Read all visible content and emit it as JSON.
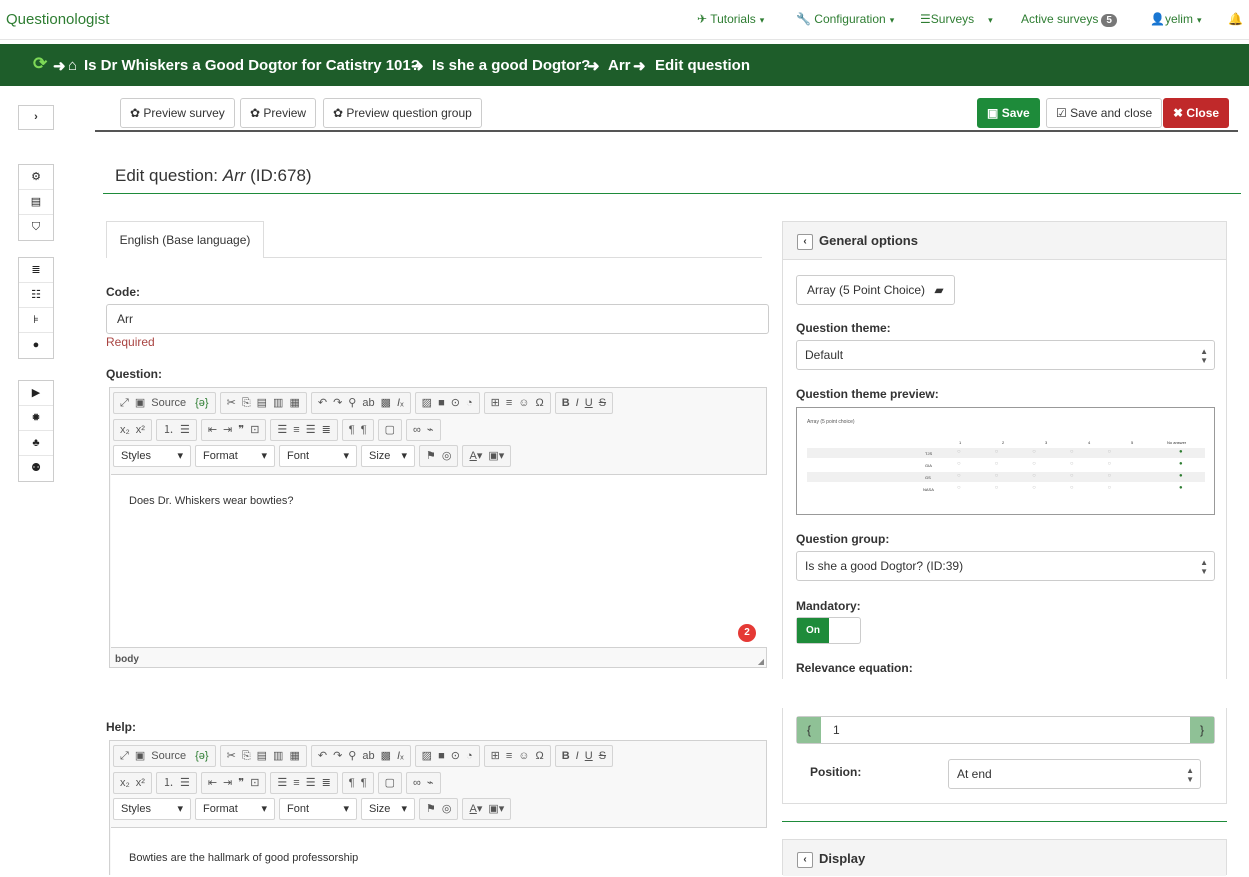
{
  "topnav": {
    "brand": "Questionologist",
    "tutorials": "Tutorials",
    "configuration": "Configuration",
    "surveys": "Surveys",
    "active_surveys": "Active surveys",
    "active_count": "5",
    "user": "yelim"
  },
  "breadcrumb": {
    "survey": "Is Dr Whiskers a Good Dogtor for Catistry 101?",
    "group": "Is she a good Dogtor?",
    "question": "Arr",
    "current": "Edit question"
  },
  "toolbar": {
    "preview_survey": "Preview survey",
    "preview": "Preview",
    "preview_group": "Preview question group",
    "save": "Save",
    "save_close": "Save and close",
    "close": "Close"
  },
  "page": {
    "title_prefix": "Edit question: ",
    "title_code": "Arr",
    "title_suffix": " (ID:678)",
    "tab_label": "English (Base language)"
  },
  "form": {
    "code_label": "Code:",
    "code_value": "Arr",
    "required": "Required",
    "question_label": "Question:",
    "question_text": "Does Dr. Whiskers wear bowties?",
    "help_label": "Help:",
    "help_text": "Bowties are the hallmark of good professorship",
    "editor_footer": "body",
    "notification_count": "2"
  },
  "editor_toolbar": {
    "source": "Source",
    "styles": "Styles",
    "format": "Format",
    "font": "Font",
    "size": "Size"
  },
  "general": {
    "heading": "General options",
    "question_type": "Array (5 Point Choice)",
    "theme_label": "Question theme:",
    "theme_value": "Default",
    "preview_label": "Question theme preview:",
    "preview_caption": "Array (5 point choice)",
    "preview_cols": [
      "1",
      "2",
      "3",
      "4",
      "5",
      "No answer"
    ],
    "preview_rows": [
      "TJS",
      "GIA",
      "GS",
      "NASA"
    ],
    "group_label": "Question group:",
    "group_value": "Is she a good Dogtor? (ID:39)",
    "mandatory_label": "Mandatory:",
    "mandatory_value": "On",
    "relevance_label": "Relevance equation:",
    "relevance_value": "1",
    "relevance_open": "{",
    "relevance_close": "}",
    "position_label": "Position:",
    "position_value": "At end"
  },
  "display": {
    "heading": "Display"
  },
  "colors": {
    "brand_green": "#1e8b3a",
    "crumb_bg": "#1e5d2a",
    "close_red": "#c0292a"
  }
}
